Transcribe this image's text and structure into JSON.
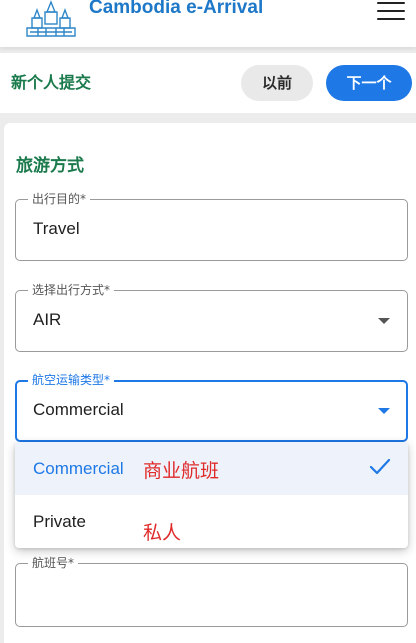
{
  "header": {
    "app_title": "Cambodia e-Arrival",
    "menu_icon": "hamburger-menu-icon",
    "logo_icon": "angkor-wat-logo"
  },
  "subheader": {
    "title": "新个人提交",
    "prev_label": "以前",
    "next_label": "下一个"
  },
  "section": {
    "title": "旅游方式"
  },
  "fields": {
    "purpose": {
      "label": "出行目的*",
      "value": "Travel"
    },
    "travel_mode": {
      "label": "选择出行方式*",
      "value": "AIR"
    },
    "air_type": {
      "label": "航空运输类型*",
      "value": "Commercial"
    },
    "flight_no": {
      "label": "航班号*",
      "value": ""
    }
  },
  "dropdown": {
    "options": [
      {
        "label": "Commercial",
        "annotation": "商业航班",
        "selected": true
      },
      {
        "label": "Private",
        "annotation": "私人",
        "selected": false
      }
    ]
  },
  "colors": {
    "brand_blue": "#1e78c8",
    "accent_blue": "#1e78e6",
    "section_green": "#1a7a4c",
    "annotation_red": "#e02a2a"
  }
}
